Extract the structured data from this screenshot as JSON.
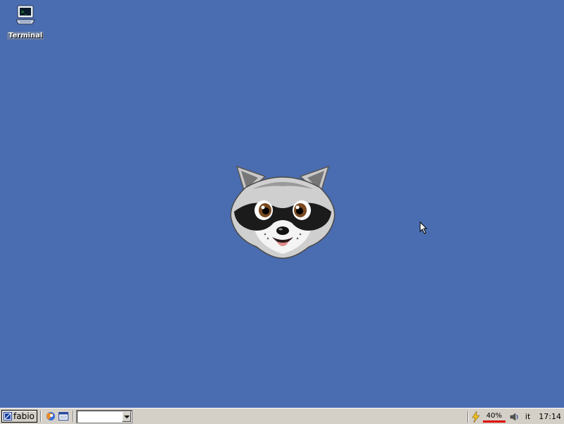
{
  "desktop": {
    "background_color": "#4a6cb0",
    "icons": [
      {
        "label": "Terminal",
        "icon": "terminal-icon"
      }
    ],
    "wallpaper": {
      "icon": "raccoon-mascot"
    }
  },
  "taskbar": {
    "start_button": {
      "label": "fabio",
      "icon": "start-logo-icon"
    },
    "quicklaunch": [
      {
        "icon": "browser-icon"
      },
      {
        "icon": "show-desktop-icon"
      }
    ],
    "window_select": {
      "value": ""
    },
    "tray": {
      "power_icon": "lightning-icon",
      "battery": {
        "label": "40%",
        "level_percent": 40,
        "color": "#e00000"
      },
      "volume_icon": "speaker-icon",
      "language": "it",
      "clock": "17:14"
    }
  }
}
